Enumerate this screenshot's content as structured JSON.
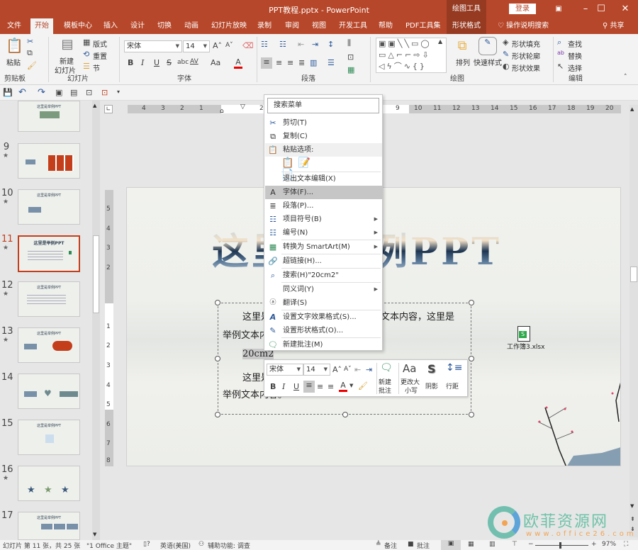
{
  "window": {
    "title": "PPT教程.pptx  -  PowerPoint",
    "context_group": "绘图工具",
    "login_label": "登录",
    "controls": [
      "ribbon-display",
      "minimize",
      "maximize",
      "close"
    ]
  },
  "tabs": [
    {
      "label": "文件"
    },
    {
      "label": "开始",
      "active": true
    },
    {
      "label": "模板中心"
    },
    {
      "label": "插入"
    },
    {
      "label": "设计"
    },
    {
      "label": "切换"
    },
    {
      "label": "动画"
    },
    {
      "label": "幻灯片放映"
    },
    {
      "label": "录制"
    },
    {
      "label": "审阅"
    },
    {
      "label": "视图"
    },
    {
      "label": "开发工具"
    },
    {
      "label": "帮助"
    },
    {
      "label": "PDF工具集"
    },
    {
      "label": "形状格式",
      "contextual": true
    }
  ],
  "tell_me": "操作说明搜索",
  "share_label": "共享",
  "ribbon": {
    "clipboard": {
      "label": "剪贴板",
      "paste": "粘贴"
    },
    "slides": {
      "label": "幻灯片",
      "new_slide_1": "新建",
      "new_slide_2": "幻灯片",
      "layout": "版式",
      "reset": "重置",
      "section": "节"
    },
    "font": {
      "label": "字体",
      "font_name": "宋体",
      "font_size": "14",
      "bold": "B",
      "italic": "I",
      "underline": "U",
      "shadow": "S",
      "strike": "abc",
      "spacing": "AV",
      "case": "Aa",
      "font_color": "A"
    },
    "paragraph": {
      "label": "段落"
    },
    "drawing": {
      "label": "绘图",
      "arrange": "排列",
      "quick_styles": "快速样式",
      "shape_fill": "形状填充",
      "shape_outline": "形状轮廓",
      "shape_effects": "形状效果"
    },
    "editing": {
      "label": "编辑",
      "find": "查找",
      "replace": "替换",
      "select": "选择"
    }
  },
  "thumbnails": [
    {
      "number": "",
      "star": false,
      "title": "这里是举例PPT"
    },
    {
      "number": "9",
      "star": true,
      "title": ""
    },
    {
      "number": "10",
      "star": true,
      "title": "这里是举例PPT"
    },
    {
      "number": "11",
      "star": true,
      "title": "这里是举例PPT",
      "current": true
    },
    {
      "number": "12",
      "star": true,
      "title": "这里是举例PPT"
    },
    {
      "number": "13",
      "star": true,
      "title": "这里是举例PPT"
    },
    {
      "number": "14",
      "star": true,
      "title": ""
    },
    {
      "number": "15",
      "star": false,
      "title": "这里是举例PPT"
    },
    {
      "number": "16",
      "star": true,
      "title": ""
    },
    {
      "number": "17",
      "star": false,
      "title": "这里是举例PPT"
    }
  ],
  "ruler": {
    "h_labels": [
      "4",
      "3",
      "2",
      "1",
      "1",
      "2",
      "9",
      "10",
      "11",
      "12",
      "13",
      "14",
      "15",
      "16",
      "17",
      "18",
      "19",
      "20"
    ],
    "v_labels": [
      "5",
      "4",
      "3",
      "2",
      "1",
      "1",
      "2",
      "3",
      "4",
      "5",
      "6",
      "7",
      "8"
    ]
  },
  "slide": {
    "title": "这里是举例PPT",
    "body": [
      "这里是举例文本内容，这里是举例文本内容，这里是",
      "举例文本内容。",
      "20cm2",
      "这里是举例文本内容，这里是举例文本内容，这里是",
      "举例文本内容。"
    ],
    "embedded_file": "工作簿3.xlsx"
  },
  "context_menu": {
    "search_placeholder": "搜索菜单",
    "items": [
      {
        "icon": "cut-icon",
        "label": "剪切(T)"
      },
      {
        "icon": "copy-icon",
        "label": "复制(C)"
      },
      {
        "icon": "paste-icon",
        "label": "粘贴选项:",
        "header": true
      },
      {
        "icon": "",
        "label": "退出文本编辑(X)"
      },
      {
        "icon": "font-icon",
        "label": "字体(F)...",
        "highlighted": true
      },
      {
        "icon": "paragraph-icon",
        "label": "段落(P)..."
      },
      {
        "icon": "bullets-icon",
        "label": "项目符号(B)",
        "submenu": true
      },
      {
        "icon": "numbering-icon",
        "label": "编号(N)",
        "submenu": true
      },
      {
        "icon": "smartart-icon",
        "label": "转换为 SmartArt(M)",
        "submenu": true
      },
      {
        "icon": "hyperlink-icon",
        "label": "超链接(H)..."
      },
      {
        "icon": "search-icon",
        "label": "搜索(H)\"20cm2\""
      },
      {
        "icon": "",
        "label": "同义词(Y)",
        "submenu": true
      },
      {
        "icon": "translate-icon",
        "label": "翻译(S)"
      },
      {
        "icon": "text-effects-icon",
        "label": "设置文字效果格式(S)..."
      },
      {
        "icon": "shape-format-icon",
        "label": "设置形状格式(O)..."
      },
      {
        "icon": "new-comment-icon",
        "label": "新建批注(M)"
      }
    ]
  },
  "mini_toolbar": {
    "font_name": "宋体",
    "font_size": "14",
    "new_comment_1": "新建",
    "new_comment_2": "批注",
    "change_case_1": "更改大",
    "change_case_2": "小写",
    "shadow": "阴影",
    "line_spacing": "行距",
    "case_glyph": "Aa",
    "shadow_glyph": "S"
  },
  "status": {
    "slide_info": "幻灯片 第 11 张，共 25 张",
    "theme": "\"1 Office 主题\"",
    "language": "英语(美国)",
    "accessibility": "辅助功能: 调查",
    "notes": "备注",
    "comments": "批注",
    "zoom": "97%"
  },
  "watermark": {
    "brand": "欧菲资源网",
    "url": "www.office26.com"
  }
}
